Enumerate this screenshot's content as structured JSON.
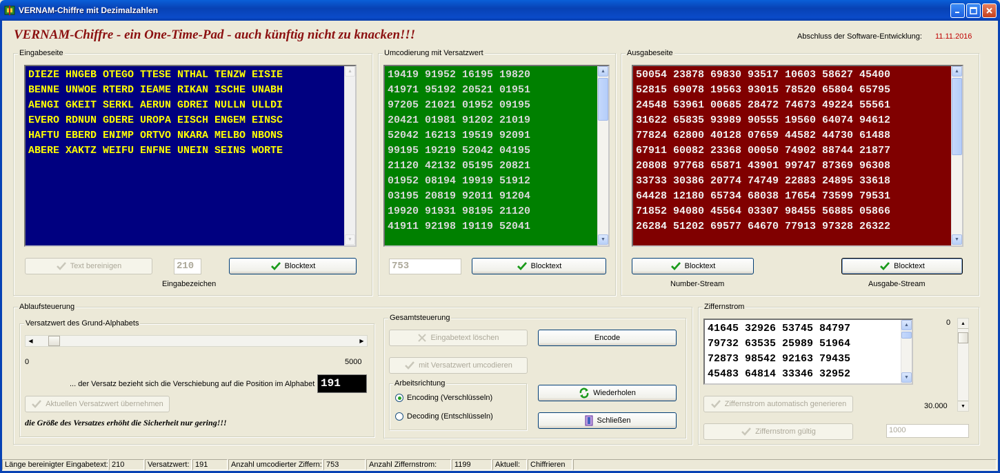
{
  "window": {
    "title": "VERNAM-Chiffre mit Dezimalzahlen"
  },
  "header": {
    "headline": "VERNAM-Chiffre - ein One-Time-Pad - auch künftig nicht zu knacken!!!",
    "dev_label": "Abschluss der Software-Entwicklung:",
    "dev_date": "11.11.2016"
  },
  "input_page": {
    "title": "Eingabeseite",
    "text": "DIEZE HNGEB OTEGO TTESE NTHAL TENZW EISIE\nBENNE UNWOE RTERD IEAME RIKAN ISCHE UNABH\nAENGI GKEIT SERKL AERUN GDREI NULLN ULLDI\nEVERO RDNUN GDERE UROPA EISCH ENGEM EINSC\nHAFTU EBERD ENIMP ORTVO NKARA MELBO NBONS\nABERE XAKTZ WEIFU ENFNE UNEIN SEINS WORTE",
    "clean_button": "Text bereinigen",
    "char_count": "210",
    "char_count_label": "Eingabezeichen",
    "block_button": "Blocktext"
  },
  "recoding": {
    "title": "Umcodierung mit Versatzwert",
    "text": "19419 91952 16195 19820\n41971 95192 20521 01951\n97205 21021 01952 09195\n20421 01981 91202 21019\n52042 16213 19519 92091\n99195 19219 52042 04195\n21120 42132 05195 20821\n01952 08194 19919 51912\n03195 20819 92011 91204\n19920 91931 98195 21120\n41911 92198 19119 52041",
    "count": "753",
    "block_button": "Blocktext"
  },
  "output_page": {
    "title": "Ausgabeseite",
    "text": "50054 23878 69830 93517 10603 58627 45400\n52815 69078 19563 93015 78520 65804 65795\n24548 53961 00685 28472 74673 49224 55561\n31622 65835 93989 90555 19560 64074 94612\n77824 62800 40128 07659 44582 44730 61488\n67911 60082 23368 00050 74902 88744 21877\n20808 97768 65871 43901 99747 87369 96308\n33733 30386 20774 74749 22883 24895 33618\n64428 12180 65734 68038 17654 73599 79531\n71852 94080 45564 03307 98455 56885 05866\n26284 51202 69577 64670 77913 97328 26322",
    "block_button_1": "Blocktext",
    "stream_label_1": "Number-Stream",
    "block_button_2": "Blocktext",
    "stream_label_2": "Ausgabe-Stream"
  },
  "flow": {
    "title": "Ablaufsteuerung",
    "offset_group": "Versatzwert des Grund-Alphabets",
    "slider_min": "0",
    "slider_max": "5000",
    "slider_value": 191,
    "slider_max_value": 5000,
    "note": "... der Versatz bezieht sich  die Verschiebung auf die Position  im Alphabet",
    "offset_value": "191",
    "apply_button": "Aktuellen Versatzwert übernehmen",
    "hint": "die Größe des Versatzes erhöht die Sicherheit nur gering!!!"
  },
  "control": {
    "title": "Gesamtsteuerung",
    "clear_button": "Eingabetext löschen",
    "encode_button": "Encode",
    "recode_button": "mit Versatzwert umcodieren",
    "direction_title": "Arbeitsrichtung",
    "radio_encode": "Encoding (Verschlüsseln)",
    "radio_decode": "Decoding (Entschlüsseln)",
    "repeat_button": "Wiederholen",
    "close_button": "Schließen"
  },
  "digit_stream": {
    "title": "Ziffernstrom",
    "text": "41645 32926 53745 84797\n79732 63535 25989 51964\n72873 98542 92163 79435\n45483 64814 33346 32952",
    "spin_top": "0",
    "spin_bottom": "30.000",
    "generate_button": "Ziffernstrom automatisch generieren",
    "valid_button": "Ziffernstrom gültig",
    "length_value": "1000"
  },
  "status": {
    "p1_label": "Länge bereinigter Eingabetext:",
    "p1_value": "210",
    "p2_label": "Versatzwert:",
    "p2_value": "191",
    "p3_label": "Anzahl umcodierter Ziffern:",
    "p3_value": "753",
    "p4_label": "Anzahl Ziffernstrom:",
    "p4_value": "1199",
    "p5_label": "Aktuell:",
    "p5_value": "Chiffrieren"
  }
}
